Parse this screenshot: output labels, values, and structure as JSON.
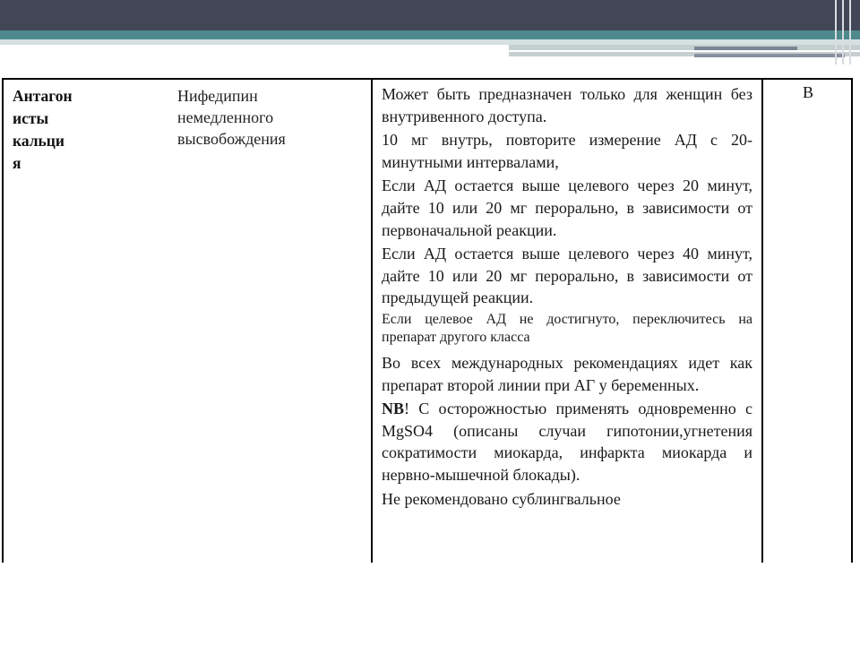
{
  "table": {
    "col1": [
      "Антагон",
      "исты",
      "кальци",
      "я"
    ],
    "col2": [
      "Нифедипин",
      "немедленного",
      "высвобождения"
    ],
    "col3": {
      "p1": "Может быть предназначен только для женщин без внутривенного доступа.",
      "p2": "10 мг внутрь, повторите измерение АД с 20-минутными интервалами,",
      "p3": "Если АД остается выше целевого через 20 минут, дайте 10 или 20 мг перорально, в зависимости от первоначальной реакции.",
      "p4": "Если АД остается выше целевого через 40 минут, дайте 10 или 20 мг перорально, в зависимости от предыдущей реакции.",
      "p5": "Если целевое АД не достигнуто, переключитесь на препарат другого класса",
      "p6": "Во всех международных рекомендациях идет как препарат второй линии при АГ у беременных.",
      "p7_bold": "NB",
      "p7": "! С осторожностью применять одновременно с MgSO4 (описаны случаи гипотонии,угнетения сократимости миокарда, инфаркта миокарда и нервно-мышечной блокады).",
      "p8": "Не рекомендовано сублингвальное"
    },
    "col4": "B"
  }
}
